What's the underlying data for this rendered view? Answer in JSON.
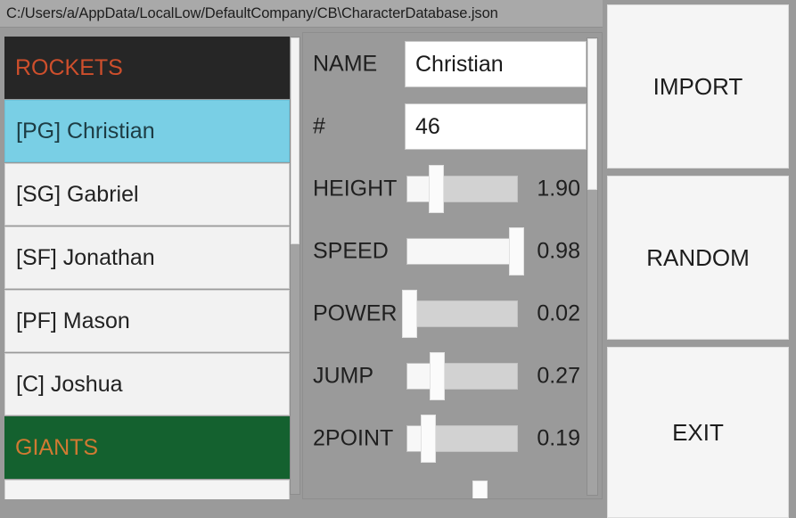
{
  "window": {
    "file_path": "C:/Users/a/AppData/LocalLow/DefaultCompany/CB\\CharacterDatabase.json"
  },
  "roster": {
    "items": [
      {
        "label": "ROCKETS",
        "kind": "team",
        "bg": "#262626",
        "fg": "#ce4f2c",
        "selected": false
      },
      {
        "label": "[PG] Christian",
        "kind": "player",
        "bg": "#79cfe5",
        "fg": "#1d3c44",
        "selected": true
      },
      {
        "label": "[SG] Gabriel",
        "kind": "player",
        "bg": "#f2f2f2",
        "fg": "#222222",
        "selected": false
      },
      {
        "label": "[SF] Jonathan",
        "kind": "player",
        "bg": "#f2f2f2",
        "fg": "#222222",
        "selected": false
      },
      {
        "label": "[PF] Mason",
        "kind": "player",
        "bg": "#f2f2f2",
        "fg": "#222222",
        "selected": false
      },
      {
        "label": "[C] Joshua",
        "kind": "player",
        "bg": "#f2f2f2",
        "fg": "#222222",
        "selected": false
      },
      {
        "label": "GIANTS",
        "kind": "team",
        "bg": "#14612f",
        "fg": "#d07a32",
        "selected": false
      },
      {
        "label": "",
        "kind": "player",
        "bg": "#f4f4f4",
        "fg": "#222222",
        "selected": false
      }
    ]
  },
  "editor": {
    "fields": [
      {
        "label": "NAME",
        "value": "Christian"
      },
      {
        "label": "#",
        "value": "46"
      }
    ],
    "sliders": [
      {
        "label": "HEIGHT",
        "value": "1.90",
        "fill_pct": 26
      },
      {
        "label": "SPEED",
        "value": "0.98",
        "fill_pct": 98
      },
      {
        "label": "POWER",
        "value": "0.02",
        "fill_pct": 2
      },
      {
        "label": "JUMP",
        "value": "0.27",
        "fill_pct": 27
      },
      {
        "label": "2POINT",
        "value": "0.19",
        "fill_pct": 19
      }
    ]
  },
  "actions": {
    "buttons": [
      {
        "label": "IMPORT"
      },
      {
        "label": "RANDOM"
      },
      {
        "label": "EXIT"
      }
    ]
  }
}
